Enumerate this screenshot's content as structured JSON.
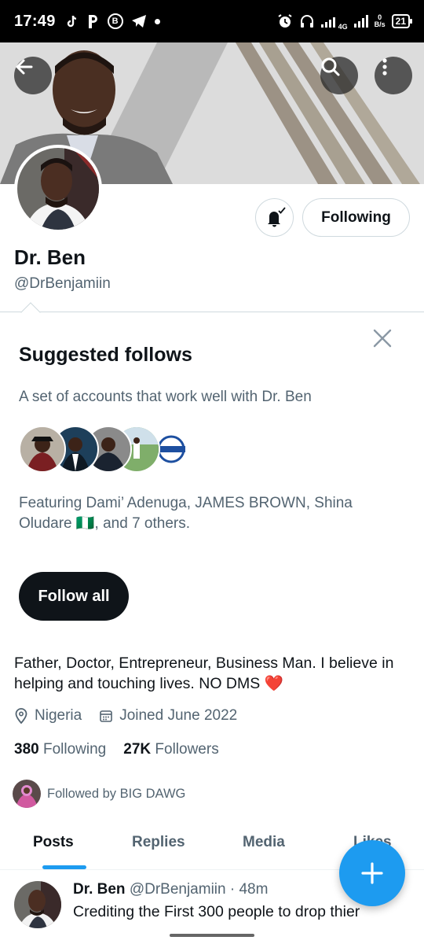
{
  "status_bar": {
    "time": "17:49",
    "network": "4G",
    "net_speed_value": "0",
    "net_speed_unit": "B/s",
    "battery": "21",
    "left_icons": [
      "tiktok-icon",
      "p-icon",
      "b-icon",
      "telegram-icon",
      "dot-icon"
    ],
    "right_icons": [
      "alarm-icon",
      "headphones-icon",
      "signal-icon",
      "battery-icon"
    ]
  },
  "header": {
    "back_icon": "arrow-left-icon",
    "search_icon": "search-icon",
    "more_icon": "more-vertical-icon"
  },
  "profile": {
    "display_name": "Dr. Ben",
    "handle": "@DrBenjamiin",
    "following_button": "Following",
    "bell_icon": "bell-subscribed-icon",
    "bio": "Father, Doctor, Entrepreneur, Business Man. I believe in helping and touching lives. NO DMS ❤️",
    "location": "Nigeria",
    "joined": "Joined June 2022",
    "following_count": "380",
    "following_label": "Following",
    "followers_count": "27K",
    "followers_label": "Followers",
    "followed_by": "Followed by BIG DAWG"
  },
  "suggested": {
    "title": "Suggested follows",
    "subtitle": "A set of accounts that work well with Dr. Ben",
    "featuring": "Featuring Dami’ Adenuga, JAMES BROWN, Shina Oludare 🇳🇬, and 7 others.",
    "follow_all": "Follow all",
    "close_icon": "close-icon"
  },
  "tabs": [
    {
      "label": "Posts",
      "active": true
    },
    {
      "label": "Replies",
      "active": false
    },
    {
      "label": "Media",
      "active": false
    },
    {
      "label": "Likes",
      "active": false
    }
  ],
  "post": {
    "author": "Dr. Ben",
    "handle": "@DrBenjamiin",
    "time": "· 48m",
    "text": "Crediting the First 300 people to drop thier"
  },
  "fab": {
    "icon": "plus-icon"
  },
  "colors": {
    "accent": "#1d9bf0",
    "text": "#0f1419",
    "muted": "#536471",
    "dark_button": "#0f1419"
  }
}
